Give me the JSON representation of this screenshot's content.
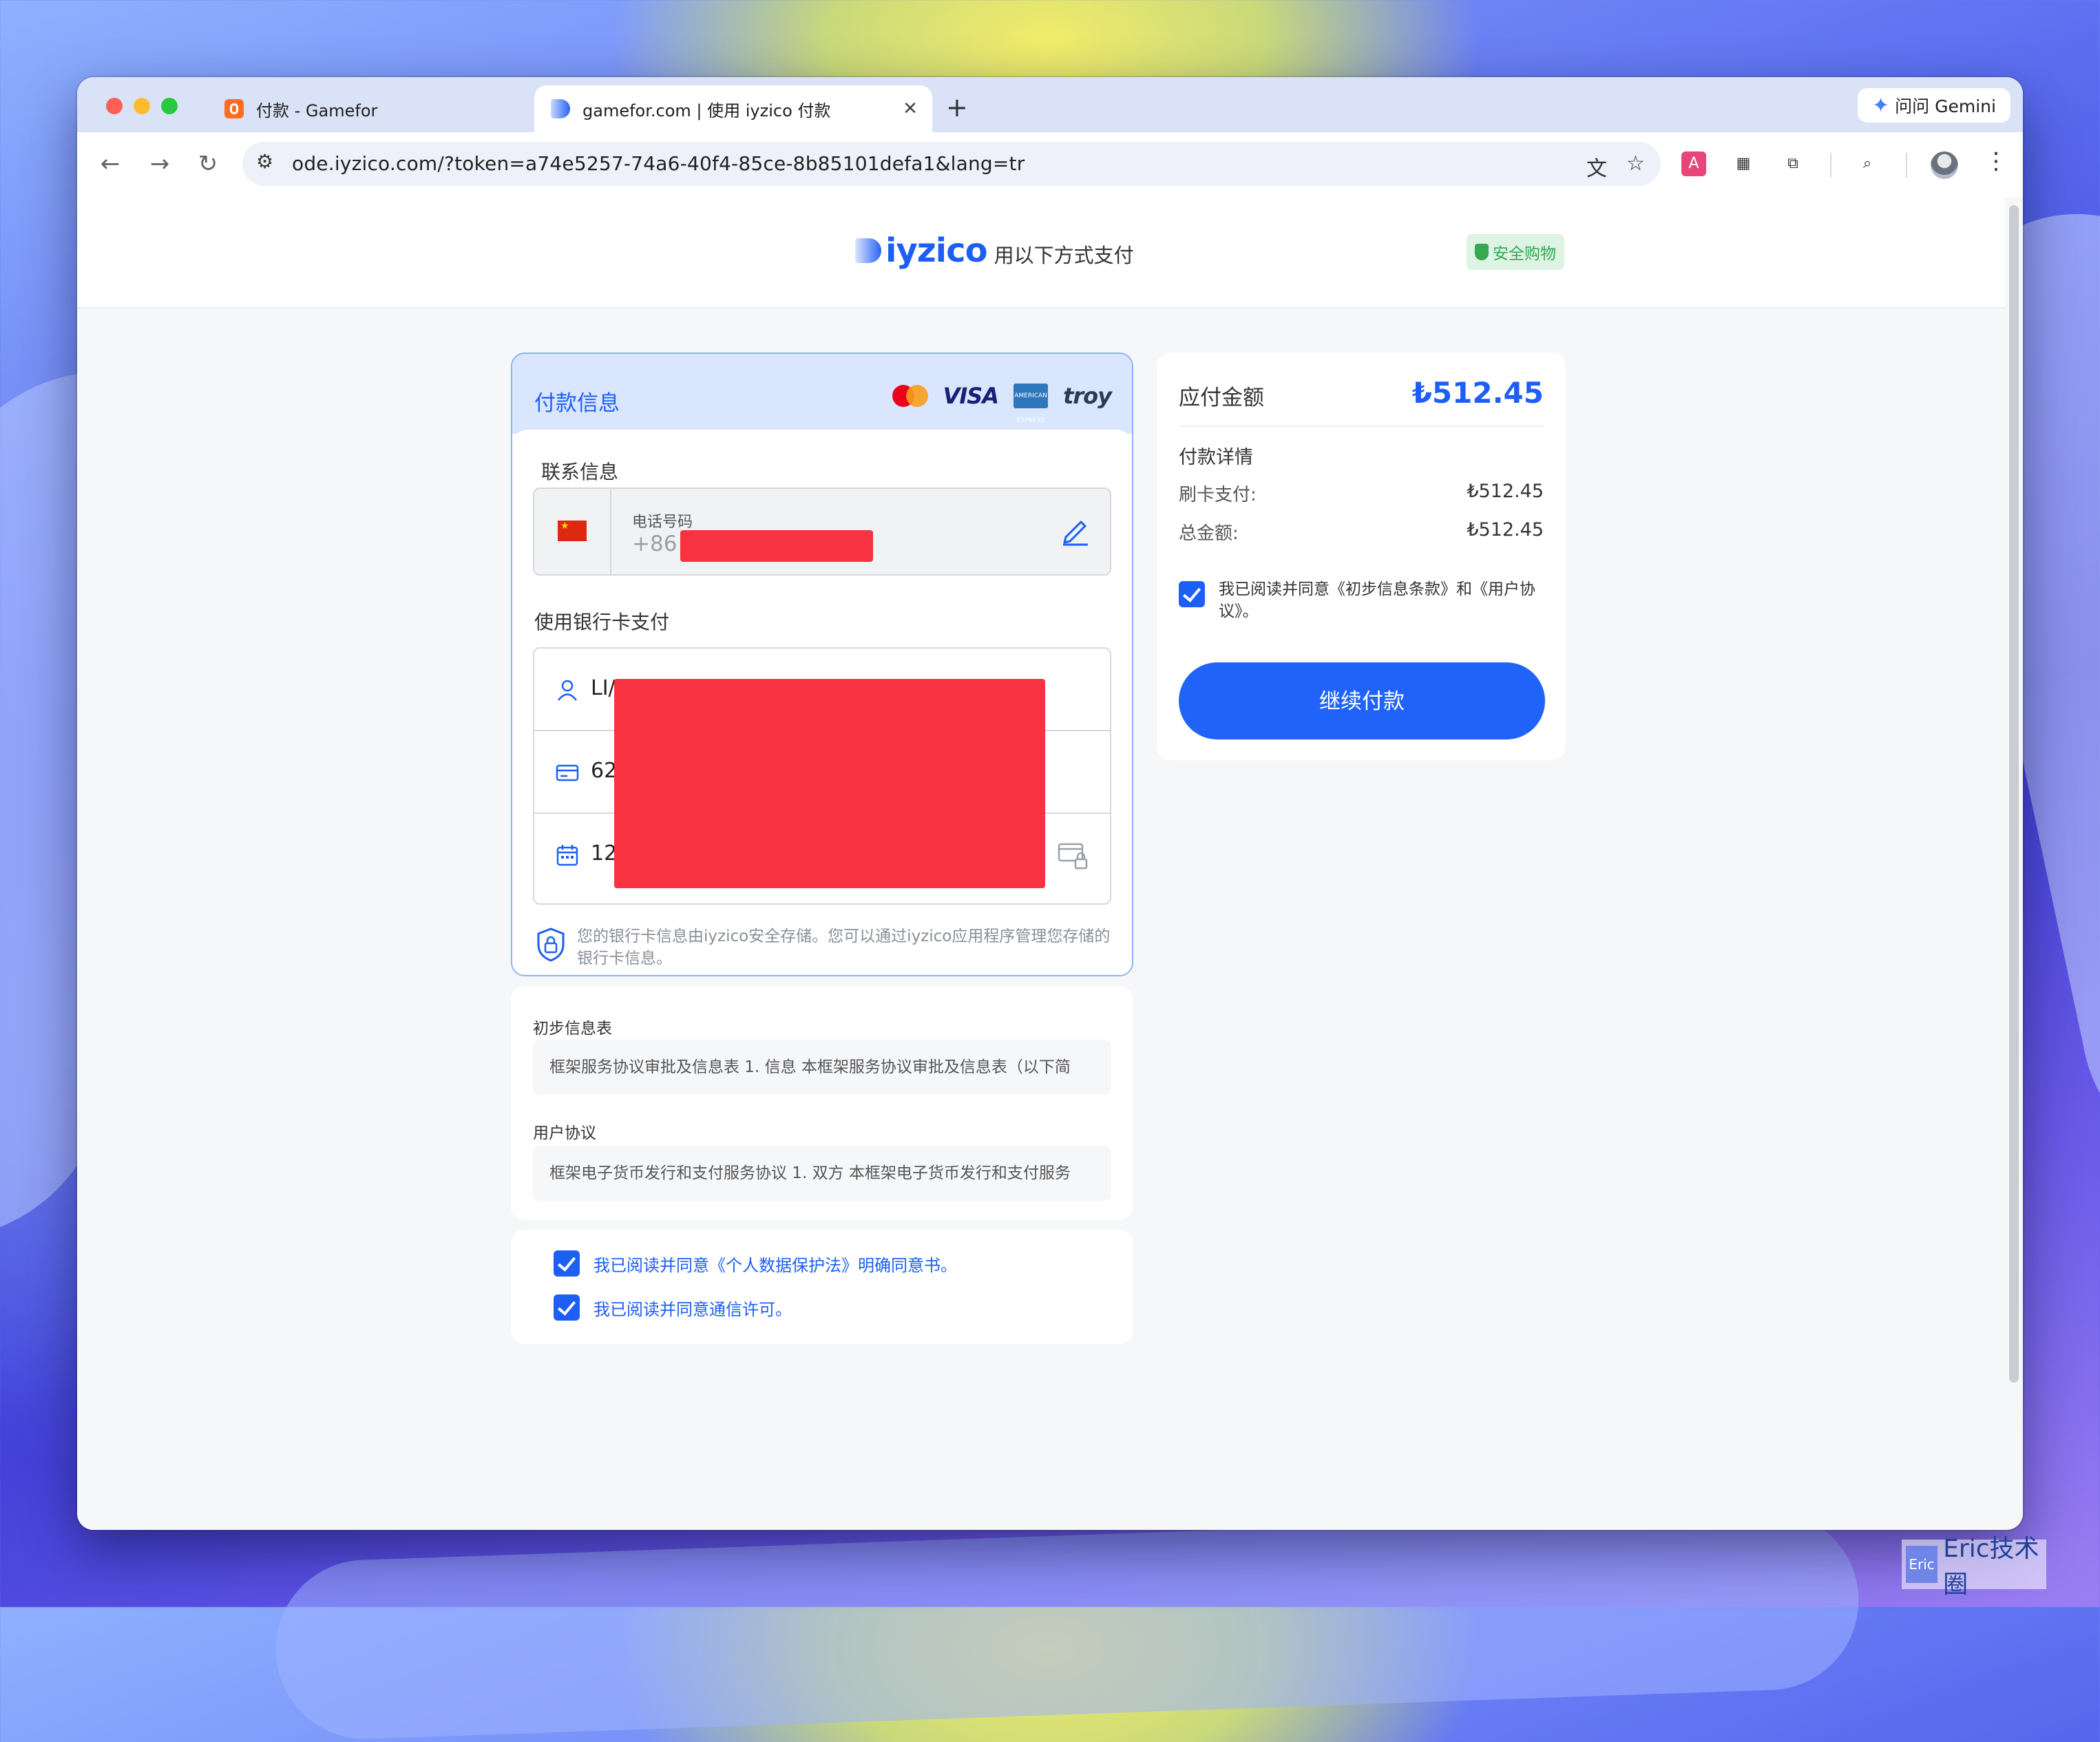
{
  "browser": {
    "tabs": [
      {
        "title": "付款 - Gamefor",
        "close": "✕"
      },
      {
        "title": "gamefor.com | 使用 iyzico 付款",
        "close": "✕"
      }
    ],
    "new_tab": "+",
    "gemini_label": "问问 Gemini",
    "url": "ode.iyzico.com/?token=a74e5257-74a6-40f4-85ce-8b85101defa1&lang=tr",
    "icons": [
      "back-icon",
      "forward-icon",
      "reload-icon",
      "translate-icon",
      "star-icon",
      "extension-icon",
      "qr-icon",
      "puzzle-icon",
      "cast-icon",
      "profile-avatar",
      "menu-icon"
    ]
  },
  "header": {
    "brand": "iyzico",
    "subtitle": "用以下方式支付",
    "secure_badge": "安全购物"
  },
  "payment": {
    "title": "付款信息",
    "card_brands": [
      "VISA",
      "AMERICAN EXPRESS",
      "troy"
    ],
    "contact_label": "联系信息",
    "phone_label": "电话号码",
    "phone_code": "+86",
    "card_section_label": "使用银行卡支付",
    "fields": [
      {
        "icon": "user-icon",
        "value": "LI/"
      },
      {
        "icon": "credit-card-icon",
        "value": "62"
      },
      {
        "icon": "calendar-icon",
        "value": "12"
      }
    ],
    "notice": "您的银行卡信息由iyzico安全存储。您可以通过iyzico应用程序管理您存储的银行卡信息。"
  },
  "terms": {
    "preliminary_label": "初步信息表",
    "preliminary_text": "框架服务协议审批及信息表 1. 信息 本框架服务协议审批及信息表（以下简",
    "user_agreement_label": "用户协议",
    "user_agreement_text": "框架电子货币发行和支付服务协议 1. 双方 本框架电子货币发行和支付服务"
  },
  "consents": [
    {
      "text": "我已阅读并同意《个人数据保护法》明确同意书。",
      "checked": true
    },
    {
      "text": "我已阅读并同意通信许可。",
      "checked": true
    }
  ],
  "summary": {
    "title": "应付金额",
    "amount": "₺512.45",
    "details_label": "付款详情",
    "rows": [
      {
        "key": "刷卡支付:",
        "value": "₺512.45"
      },
      {
        "key": "总金额:",
        "value": "₺512.45"
      }
    ],
    "agree_text": "我已阅读并同意《初步信息条款》和《用户协议》。",
    "agree_checked": true,
    "button": "继续付款"
  },
  "watermark": {
    "box": "Eric",
    "text": "Eric技术圈"
  },
  "colors": {
    "accent": "#1d5ff5",
    "redaction": "#f73241",
    "secure_green": "#34a853"
  }
}
